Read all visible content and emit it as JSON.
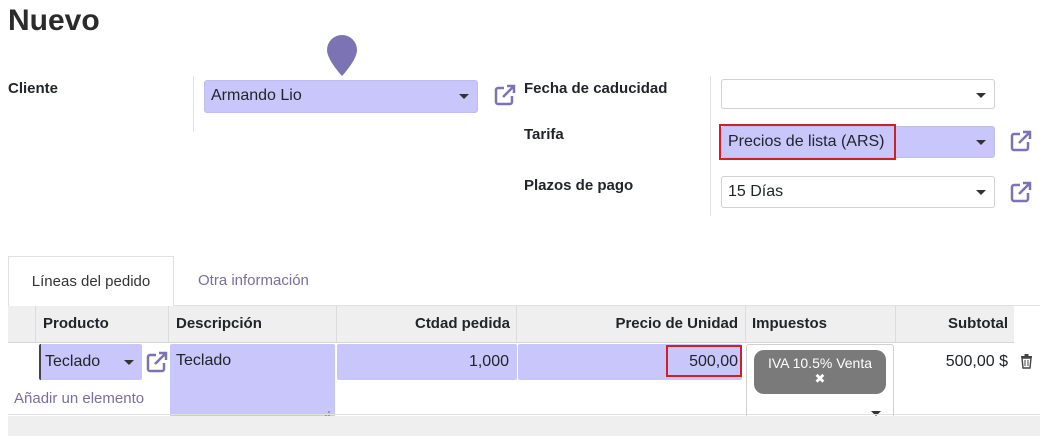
{
  "page": {
    "title": "Nuevo"
  },
  "form": {
    "cliente": {
      "label": "Cliente",
      "value": "Armando Lio"
    },
    "fecha_caducidad": {
      "label": "Fecha de caducidad",
      "value": ""
    },
    "tarifa": {
      "label": "Tarifa",
      "value": "Precios de lista (ARS)"
    },
    "plazos_pago": {
      "label": "Plazos de pago",
      "value": "15 Días"
    }
  },
  "tabs": [
    {
      "label": "Líneas del pedido",
      "active": true
    },
    {
      "label": "Otra información",
      "active": false
    }
  ],
  "table": {
    "headers": {
      "producto": "Producto",
      "descripcion": "Descripción",
      "cantidad": "Ctdad pedida",
      "precio": "Precio de Unidad",
      "impuestos": "Impuestos",
      "subtotal": "Subtotal"
    },
    "rows": [
      {
        "producto": "Teclado",
        "descripcion": "Teclado",
        "cantidad": "1,000",
        "precio": "500,00",
        "impuesto_tag": "IVA 10.5% Venta",
        "impuesto_remove": "✖",
        "subtotal": "500,00 $"
      }
    ],
    "add_line": "Añadir un elemento"
  },
  "icons": {
    "external_link": "external-link-icon",
    "dropdown": "chevron-down-icon",
    "trash": "trash-icon",
    "pin": "map-pin-icon"
  },
  "colors": {
    "required_field_bg": "#c9c6fb",
    "highlight_border": "#d11f2a",
    "tab_inactive_text": "#7a6f99",
    "tag_bg": "#7a7a7a"
  }
}
